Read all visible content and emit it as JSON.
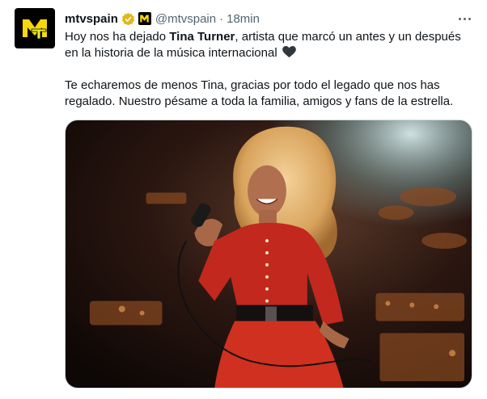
{
  "tweet": {
    "display_name": "mtvspain",
    "handle": "@mtvspain",
    "separator": "·",
    "time": "18min",
    "paragraph1": {
      "before": "Hoy nos ha dejado ",
      "bold": "Tina Turner",
      "after": ", artista que marcó un antes y un después en la historia de la música internacional"
    },
    "paragraph2": "Te echaremos de menos Tina, gracias por todo el legado que nos has regalado. Nuestro pésame a toda la familia, amigos y fans de la estrella.",
    "icons": {
      "avatar": "mtv-logo-icon",
      "verified": "verified-badge-icon",
      "affiliate": "mtv-affiliate-icon",
      "heart": "black-heart-icon",
      "more": "more-options-icon"
    },
    "colors": {
      "verified_gold": "#e2b719",
      "mtv_yellow": "#f5d90a",
      "secondary_text": "#536471",
      "primary_text": "#0f1419"
    }
  }
}
